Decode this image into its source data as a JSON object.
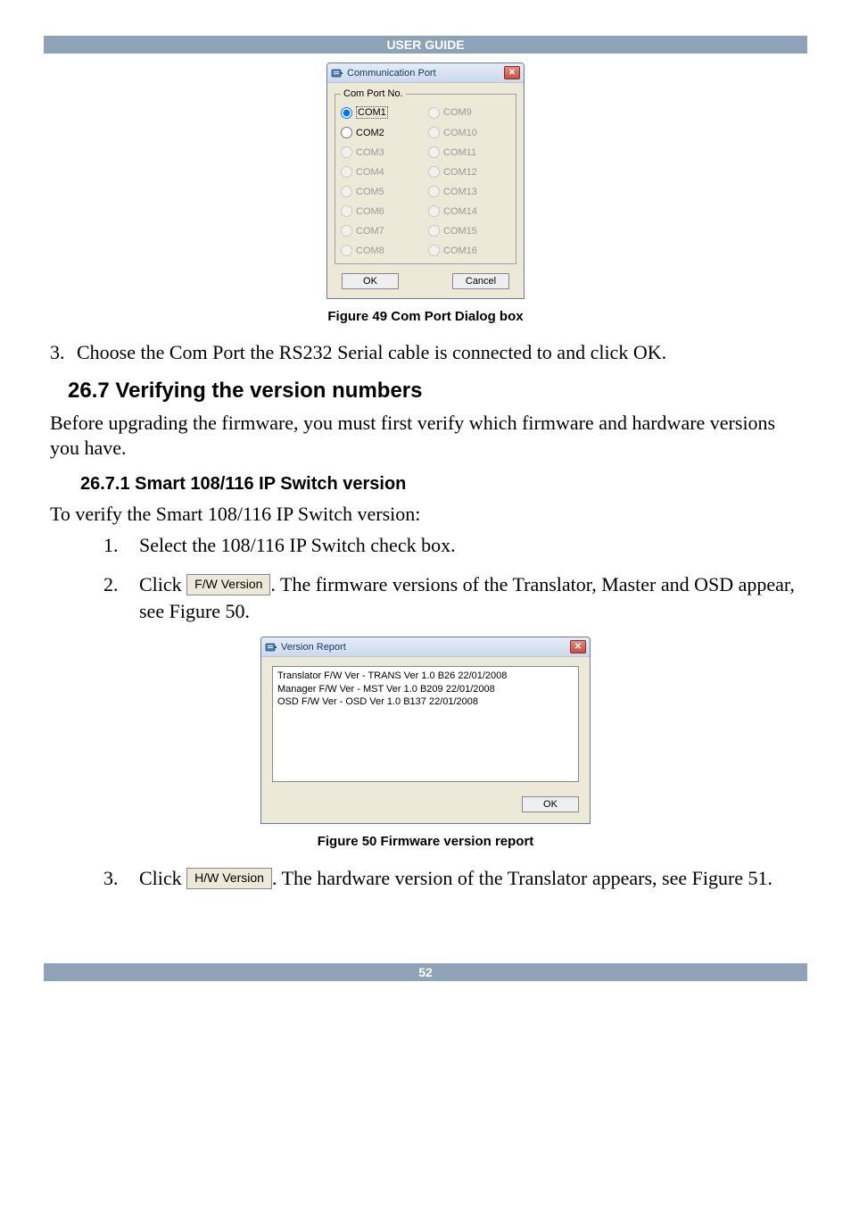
{
  "header": {
    "title": "USER GUIDE"
  },
  "footer": {
    "page_number": "52"
  },
  "comport_dialog": {
    "title": "Communication Port",
    "group": "Com Port No.",
    "ports_left": [
      {
        "label": "COM1",
        "enabled": true,
        "selected": true
      },
      {
        "label": "COM2",
        "enabled": true,
        "selected": false
      },
      {
        "label": "COM3",
        "enabled": false,
        "selected": false
      },
      {
        "label": "COM4",
        "enabled": false,
        "selected": false
      },
      {
        "label": "COM5",
        "enabled": false,
        "selected": false
      },
      {
        "label": "COM6",
        "enabled": false,
        "selected": false
      },
      {
        "label": "COM7",
        "enabled": false,
        "selected": false
      },
      {
        "label": "COM8",
        "enabled": false,
        "selected": false
      }
    ],
    "ports_right": [
      {
        "label": "COM9",
        "enabled": false,
        "selected": false
      },
      {
        "label": "COM10",
        "enabled": false,
        "selected": false
      },
      {
        "label": "COM11",
        "enabled": false,
        "selected": false
      },
      {
        "label": "COM12",
        "enabled": false,
        "selected": false
      },
      {
        "label": "COM13",
        "enabled": false,
        "selected": false
      },
      {
        "label": "COM14",
        "enabled": false,
        "selected": false
      },
      {
        "label": "COM15",
        "enabled": false,
        "selected": false
      },
      {
        "label": "COM16",
        "enabled": false,
        "selected": false
      }
    ],
    "ok": "OK",
    "cancel": "Cancel",
    "close_glyph": "✕"
  },
  "captions": {
    "fig49": "Figure 49 Com Port Dialog box",
    "fig50": "Figure 50 Firmware version report"
  },
  "para": {
    "step3_top_num": "3.",
    "step3_top": "Choose the Com Port the RS232 Serial cable is connected to and click OK.",
    "sec267": "26.7 Verifying the version numbers",
    "sec267_body": "Before upgrading the firmware, you must first verify which firmware and hardware versions you have.",
    "sec2671": "26.7.1 Smart 108/116 IP Switch version",
    "sec2671_intro": "To verify the Smart 108/116 IP Switch version:",
    "li1_num": "1.",
    "li1": "Select the 108/116 IP Switch check box.",
    "li2_num": "2.",
    "li2_a": "Click ",
    "fw_button": "F/W Version",
    "li2_b": ". The firmware versions of the Translator, Master and OSD appear, see Figure 50.",
    "li3_num": "3.",
    "li3_a": "Click ",
    "hw_button": "H/W Version",
    "li3_b": ". The hardware version of the Translator appears, see Figure 51."
  },
  "version_dialog": {
    "title": "Version Report",
    "lines": "Translator F/W Ver - TRANS Ver 1.0 B26 22/01/2008\nManager F/W Ver - MST Ver 1.0 B209 22/01/2008\nOSD F/W Ver - OSD Ver 1.0 B137 22/01/2008",
    "ok": "OK",
    "close_glyph": "✕"
  }
}
